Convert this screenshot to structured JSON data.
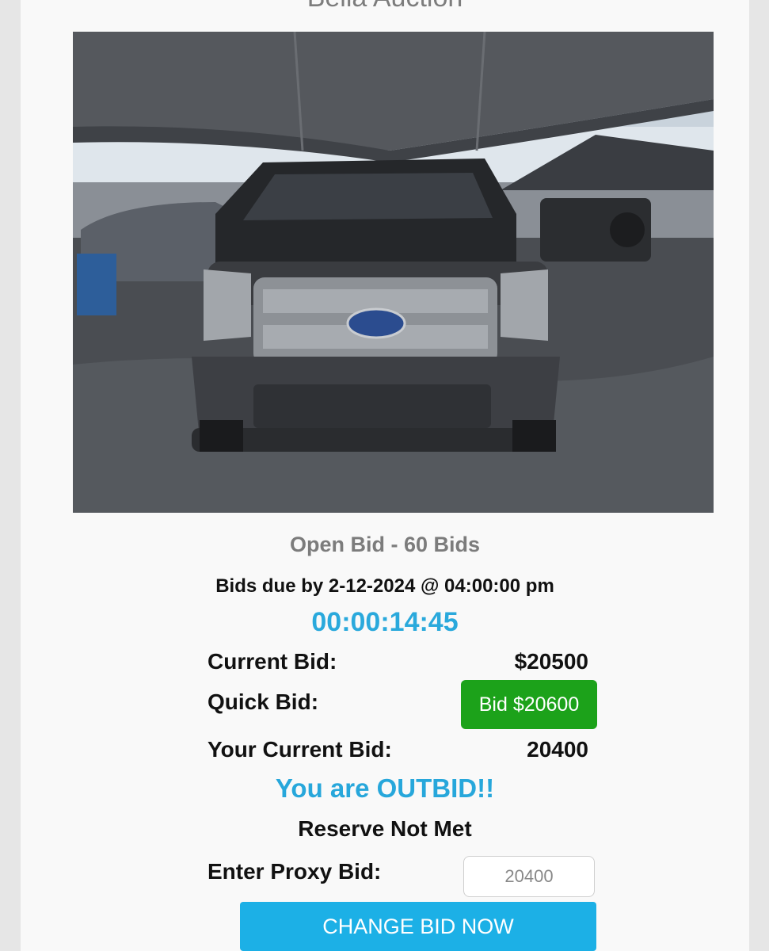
{
  "header": {
    "title": "Bella Auction"
  },
  "listing": {
    "photo_description": "vehicle-photo",
    "bid_status": "Open Bid - 60 Bids",
    "bids_due": "Bids due by 2-12-2024 @ 04:00:00 pm",
    "countdown": "00:00:14:45"
  },
  "bidding": {
    "current_bid_label": "Current Bid:",
    "current_bid_value": "$20500",
    "quick_bid_label": "Quick Bid:",
    "quick_bid_button": "Bid $20600",
    "your_bid_label": "Your Current Bid:",
    "your_bid_value": "20400",
    "outbid_message": "You are OUTBID!!",
    "reserve_status": "Reserve Not Met",
    "proxy_label": "Enter Proxy Bid:",
    "proxy_placeholder": "20400",
    "submit_button": "CHANGE BID NOW"
  },
  "colors": {
    "accent_blue": "#27a7db",
    "quick_bid_green": "#1ca21a",
    "button_blue": "#1cb0e6"
  }
}
